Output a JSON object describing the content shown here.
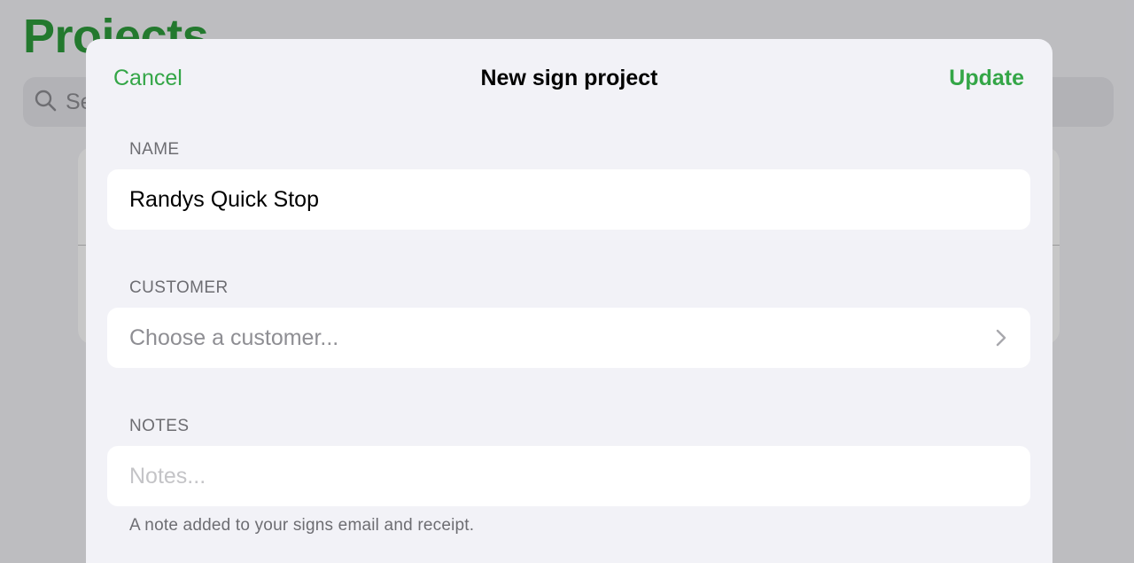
{
  "background": {
    "title": "Projects",
    "search_placeholder": "Se"
  },
  "sheet": {
    "cancel_label": "Cancel",
    "title": "New sign project",
    "update_label": "Update",
    "name": {
      "label": "NAME",
      "value": "Randys Quick Stop"
    },
    "customer": {
      "label": "CUSTOMER",
      "placeholder": "Choose a customer..."
    },
    "notes": {
      "label": "NOTES",
      "placeholder": "Notes...",
      "footnote": "A note added to your signs email and receipt."
    }
  },
  "colors": {
    "accent": "#34a647",
    "background_title": "#2e9b3c"
  },
  "icons": {
    "search": "search-icon",
    "chevron": "chevron-right-icon"
  }
}
